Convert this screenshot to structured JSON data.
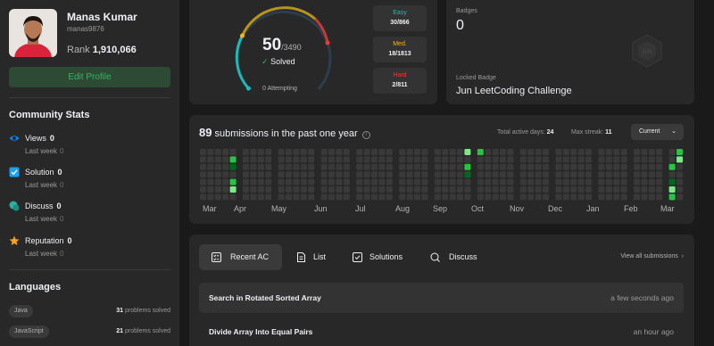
{
  "profile": {
    "name": "Manas Kumar",
    "username": "manas9876",
    "rank_label": "Rank",
    "rank_value": "1,910,066",
    "edit_label": "Edit Profile"
  },
  "community": {
    "title": "Community Stats",
    "stats": [
      {
        "label": "Views",
        "value": "0",
        "sub_label": "Last week",
        "sub_value": "0",
        "icon": "eye-icon",
        "color": "#0a84ff"
      },
      {
        "label": "Solution",
        "value": "0",
        "sub_label": "Last week",
        "sub_value": "0",
        "icon": "solution-icon",
        "color": "#1ca1f2"
      },
      {
        "label": "Discuss",
        "value": "0",
        "sub_label": "Last week",
        "sub_value": "0",
        "icon": "discuss-icon",
        "color": "#2bb0a0"
      },
      {
        "label": "Reputation",
        "value": "0",
        "sub_label": "Last week",
        "sub_value": "0",
        "icon": "star-icon",
        "color": "#ffa116"
      }
    ]
  },
  "languages": {
    "title": "Languages",
    "items": [
      {
        "name": "Java",
        "count": "31",
        "suffix": "problems solved"
      },
      {
        "name": "JavaScript",
        "count": "21",
        "suffix": "problems solved"
      }
    ]
  },
  "solved": {
    "count": "50",
    "total": "/3490",
    "status": "Solved",
    "attempting_count": "0",
    "attempting_label": "Attempting",
    "difficulties": [
      {
        "label": "Easy",
        "value": "30/866",
        "color": "#1cbaba"
      },
      {
        "label": "Med.",
        "value": "18/1813",
        "color": "#ffb800"
      },
      {
        "label": "Hard",
        "value": "2/811",
        "color": "#f63737"
      }
    ]
  },
  "badges": {
    "title": "Badges",
    "count": "0",
    "locked_label": "Locked Badge",
    "locked_name": "Jun LeetCoding Challenge"
  },
  "heatmap": {
    "count": "89",
    "title_suffix": "submissions in the past one year",
    "active_label": "Total active days:",
    "active_value": "24",
    "streak_label": "Max streak:",
    "streak_value": "11",
    "range_select": "Current",
    "months": [
      "Mar",
      "Apr",
      "May",
      "Jun",
      "Jul",
      "Aug",
      "Sep",
      "Oct",
      "Nov",
      "Dec",
      "Jan",
      "Feb",
      "Mar"
    ],
    "colors": {
      "empty": "#393939",
      "level1": "#016620",
      "level2": "#28c244",
      "level3": "#7ee787"
    }
  },
  "recent": {
    "tabs": [
      {
        "label": "Recent AC",
        "icon": "recent-ac-icon"
      },
      {
        "label": "List",
        "icon": "list-icon"
      },
      {
        "label": "Solutions",
        "icon": "solutions-icon"
      },
      {
        "label": "Discuss",
        "icon": "discuss-icon"
      }
    ],
    "view_all": "View all submissions",
    "submissions": [
      {
        "title": "Search in Rotated Sorted Array",
        "time": "a few seconds ago"
      },
      {
        "title": "Divide Array Into Equal Pairs",
        "time": "an hour ago"
      }
    ]
  }
}
